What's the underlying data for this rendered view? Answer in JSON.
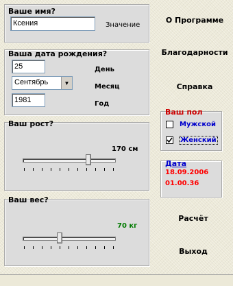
{
  "name_group": {
    "title": "Ваше имя?",
    "value": "Ксения",
    "value_label": "Значение"
  },
  "birth_group": {
    "title": "Ваша дата рождения?",
    "day": "25",
    "day_label": "День",
    "month": "Сентябрь",
    "month_label": "Месяц",
    "year": "1981",
    "year_label": "Год"
  },
  "height_group": {
    "title": "Ваш рост?",
    "value_text": "170 см",
    "level": 0.72
  },
  "weight_group": {
    "title": "Ваш вес?",
    "value_text": "70 кг",
    "level": 0.4,
    "value_color": "#007a00"
  },
  "nav": {
    "about": "О Программе",
    "thanks": "Благодарности",
    "help": "Справка",
    "calculate": "Расчёт",
    "exit": "Выход"
  },
  "gender": {
    "title": "Ваш пол",
    "male": "Мужской",
    "female": "Женский",
    "selected": "female",
    "title_color": "#cc0000",
    "option_color": "#0000cc"
  },
  "date_panel": {
    "title": "Дата",
    "date": "18.09.2006",
    "time": "01.00.36",
    "title_color": "#0000cc",
    "value_color": "#ff0000"
  },
  "icons": {
    "dropdown": "chevron-down-icon",
    "check": "check-icon"
  }
}
